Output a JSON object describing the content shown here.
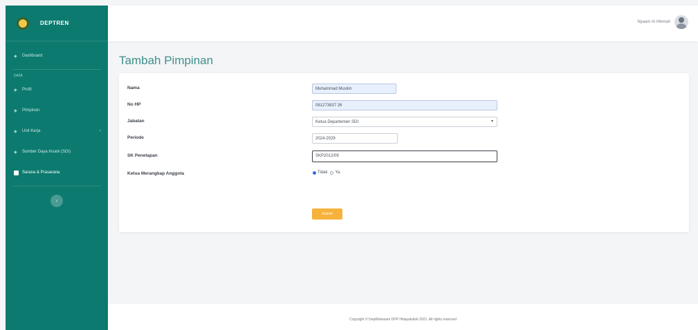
{
  "brand": {
    "name": "DEPTREN"
  },
  "sidebar": {
    "items": [
      {
        "label": "Dashboard",
        "icon": "dashboard-icon"
      },
      {
        "label": "Profil",
        "icon": "user-icon"
      },
      {
        "label": "Pimpinan",
        "icon": "users-icon"
      },
      {
        "label": "Unit Kerja",
        "icon": "folder-icon"
      },
      {
        "label": "Sumber Daya Insani (SDI)",
        "icon": "people-icon"
      },
      {
        "label": "Sarana & Prasarana",
        "icon": "building-icon"
      }
    ],
    "heading": "DATA"
  },
  "topbar": {
    "user_name": "Nyaam Al Hikmah"
  },
  "page": {
    "title": "Tambah Pimpinan"
  },
  "form": {
    "nama": {
      "label": "Nama",
      "value": "Muhammad Muslim"
    },
    "no_hp": {
      "label": "No HP",
      "value": "081273837 26"
    },
    "jabatan": {
      "label": "Jabatan",
      "value": "Ketua Departemen SDI"
    },
    "periode": {
      "label": "Periode",
      "value": "2024-2029"
    },
    "sk": {
      "label": "SK Penetapan",
      "value": "SKP2012/09"
    },
    "ketua": {
      "label": "Ketua Merangkap Anggota",
      "options": [
        "Tidak",
        "Ya"
      ],
      "selected": "Tidak"
    },
    "submit_label": "Submit"
  },
  "footer": {
    "text": "Copyright © DeptMukaram DPP Hidayatullah 2021. All rights reserved"
  },
  "colors": {
    "sidebar": "#0c7a6f",
    "title": "#3d8f8a",
    "submit": "#f6b23a"
  }
}
